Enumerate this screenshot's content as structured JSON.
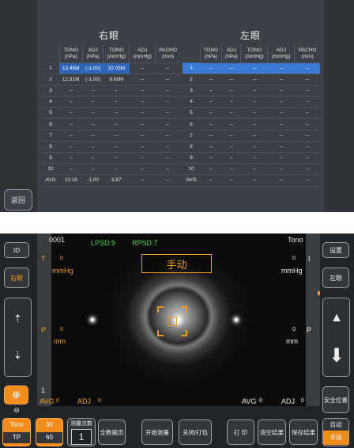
{
  "top_panel": {
    "right_eye_title": "右眼",
    "left_eye_title": "左眼",
    "back_button": "返回",
    "headers": [
      {
        "l1": "TONO",
        "l2": "(hPa)"
      },
      {
        "l1": "ADJ",
        "l2": "(hPa)"
      },
      {
        "l1": "TONO",
        "l2": "(mmHg)"
      },
      {
        "l1": "ADJ",
        "l2": "(mmHg)"
      },
      {
        "l1": "PACHO",
        "l2": "(mm)"
      }
    ],
    "right_rows": [
      [
        "1",
        "13.40M",
        "(-1.00)",
        "10.05M",
        "--",
        "--"
      ],
      [
        "2",
        "12.91M",
        "(-1.00)",
        "9.68M",
        "--",
        "--"
      ],
      [
        "3",
        "--",
        "--",
        "--",
        "--",
        "--"
      ],
      [
        "4",
        "--",
        "--",
        "--",
        "--",
        "--"
      ],
      [
        "5",
        "--",
        "--",
        "--",
        "--",
        "--"
      ],
      [
        "6",
        "--",
        "--",
        "--",
        "--",
        "--"
      ],
      [
        "7",
        "--",
        "--",
        "--",
        "--",
        "--"
      ],
      [
        "8",
        "--",
        "--",
        "--",
        "--",
        "--"
      ],
      [
        "9",
        "--",
        "--",
        "--",
        "--",
        "--"
      ],
      [
        "10",
        "--",
        "--",
        "--",
        "--",
        "--"
      ],
      [
        "AVG",
        "13.16",
        "-1.00",
        "9.87",
        "--",
        "--"
      ]
    ],
    "left_rows": [
      [
        "1",
        "--",
        "--",
        "--",
        "--",
        "--"
      ],
      [
        "2",
        "--",
        "--",
        "--",
        "--",
        "--"
      ],
      [
        "3",
        "--",
        "--",
        "--",
        "--",
        "--"
      ],
      [
        "4",
        "--",
        "--",
        "--",
        "--",
        "--"
      ],
      [
        "5",
        "--",
        "--",
        "--",
        "--",
        "--"
      ],
      [
        "6",
        "--",
        "--",
        "--",
        "--",
        "--"
      ],
      [
        "7",
        "--",
        "--",
        "--",
        "--",
        "--"
      ],
      [
        "8",
        "--",
        "--",
        "--",
        "--",
        "--"
      ],
      [
        "9",
        "--",
        "--",
        "--",
        "--",
        "--"
      ],
      [
        "10",
        "--",
        "--",
        "--",
        "--",
        "--"
      ],
      [
        "AVG",
        "--",
        "--",
        "--",
        "--",
        "--"
      ]
    ]
  },
  "bottom_panel": {
    "patient_no": "0001",
    "lpsd": "LPSD:9",
    "rpsd": "RPSD:7",
    "tono_label": "Tono",
    "mode": "手动",
    "t_label": "T",
    "t_value": "0",
    "i_label": "I",
    "i_value": "0",
    "mmhg_left": "mmHg",
    "mmhg_right": "mmHg",
    "p_label": "P",
    "p_value": "0",
    "p_right_label": "P",
    "p_right_value": "0",
    "mm_left": "mm",
    "mm_right": "mm",
    "count": "1",
    "avg_left_label": "AVG",
    "avg_left_value": "0",
    "adj_left_label": "ADJ",
    "adj_left_value": "0",
    "avg_right_label": "AVG",
    "avg_right_value": "0",
    "adj_right_label": "ADJ",
    "adj_right_value": "0",
    "buttons": {
      "id": "ID",
      "right_eye": "右眼",
      "settings": "设置",
      "left_eye": "左眼",
      "safety": "安全位置",
      "tono": "Tono",
      "tp": "TP",
      "v30": "30",
      "v60": "60",
      "measure_count_label": "测量次数",
      "measure_count_value": "1",
      "all_data": "全数据页",
      "start": "开始测量",
      "toggle": "关闭/打包",
      "print": "打 印",
      "clear": "清空结果",
      "save": "保存结果",
      "auto": "自动",
      "manual": "手动"
    }
  }
}
